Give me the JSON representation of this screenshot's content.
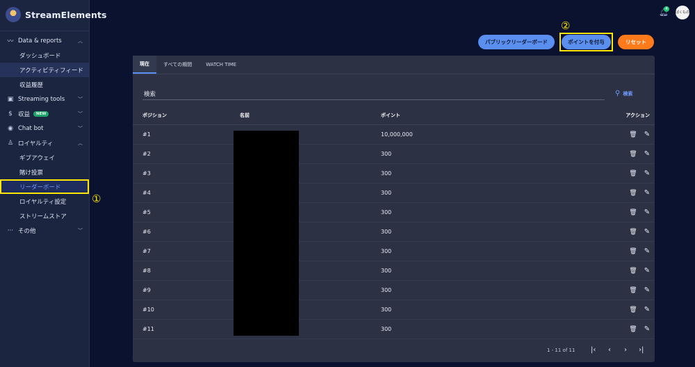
{
  "brand": {
    "name": "StreamElements"
  },
  "sidebar": {
    "sections": [
      {
        "label": "Data & reports",
        "icon": "chart-line-icon",
        "expanded": true,
        "items": [
          "ダッシュボード",
          "アクティビティフィード",
          "収益履歴"
        ]
      },
      {
        "label": "Streaming tools",
        "icon": "layout-icon",
        "expanded": false,
        "items": []
      },
      {
        "label": "収益",
        "badge": "NEW",
        "icon": "dollar-icon",
        "expanded": false,
        "items": []
      },
      {
        "label": "Chat bot",
        "icon": "chat-icon",
        "expanded": false,
        "items": []
      },
      {
        "label": "ロイヤルティ",
        "icon": "loyalty-icon",
        "expanded": true,
        "items": [
          "ギブアウェイ",
          "賭け投票",
          "リーダーボード",
          "ロイヤルティ設定",
          "ストリームストア"
        ]
      },
      {
        "label": "その他",
        "icon": "more-icon",
        "expanded": false,
        "items": []
      }
    ],
    "annotation_1": "①"
  },
  "topbar": {
    "notification_count": "4",
    "avatar_text": "ぱくもの"
  },
  "actions": {
    "public_leaderboard": "パブリックリーダーボード",
    "award_points": "ポイントを付与",
    "reset": "リセット",
    "annotation_2": "②"
  },
  "tabs": [
    "現在",
    "すべての期間",
    "WATCH TIME"
  ],
  "search": {
    "label": "検索",
    "button": "検索"
  },
  "table": {
    "headers": [
      "ポジション",
      "名前",
      "ポイント",
      "アクション"
    ],
    "rows": [
      {
        "position": "#1",
        "points": "10,000,000"
      },
      {
        "position": "#2",
        "points": "300"
      },
      {
        "position": "#3",
        "points": "300"
      },
      {
        "position": "#4",
        "points": "300"
      },
      {
        "position": "#5",
        "points": "300"
      },
      {
        "position": "#6",
        "points": "300"
      },
      {
        "position": "#7",
        "points": "300"
      },
      {
        "position": "#8",
        "points": "300"
      },
      {
        "position": "#9",
        "points": "300"
      },
      {
        "position": "#10",
        "points": "300"
      },
      {
        "position": "#11",
        "points": "300"
      }
    ]
  },
  "pagination": {
    "range": "1 - 11 of 11"
  },
  "colors": {
    "accent": "#5a8ff0",
    "reset": "#ff7a1a",
    "highlight": "#ffe600",
    "background": "#0b1230"
  }
}
